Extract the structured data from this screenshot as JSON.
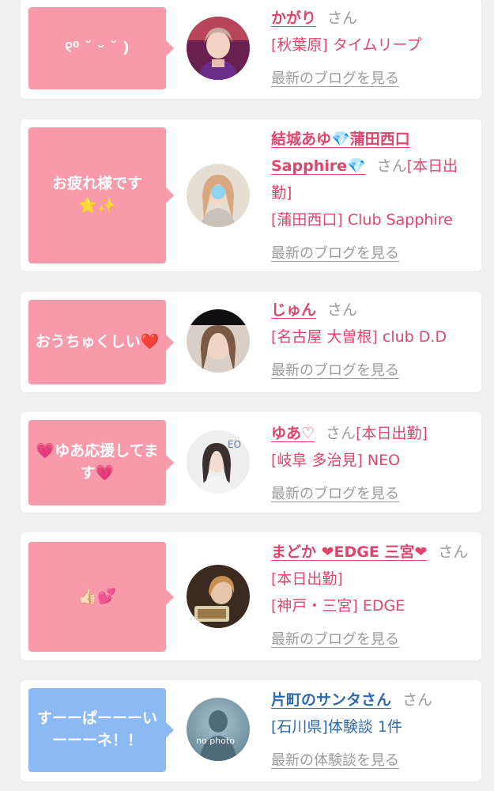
{
  "colors": {
    "pink_bubble": "#f99aab",
    "blue_bubble": "#8ab9f3",
    "pink_text": "#e0456b",
    "blue_text": "#2f6aa8",
    "gray_text": "#9b9b9b"
  },
  "cards": [
    {
      "message": "୧⁰ ˘ ᵕ ˘ )",
      "name": "かがり",
      "san": "さん",
      "tag": "",
      "shop": "[秋葉原] タイムリープ",
      "link": "最新のブログを見る",
      "avatar": "profile-photo"
    },
    {
      "message": "お疲れ様です\n⭐✨",
      "name": "結城あゆ💎蒲田西口Sapphire💎",
      "san": "さん",
      "tag": "[本日出勤]",
      "shop": "[蒲田西口] Club Sapphire",
      "link": "最新のブログを見る",
      "avatar": "profile-photo"
    },
    {
      "message": "おうちゅくしい❤️",
      "name": "じゅん",
      "san": "さん",
      "tag": "",
      "shop": "[名古屋 大曽根] club D.D",
      "link": "最新のブログを見る",
      "avatar": "profile-photo"
    },
    {
      "message": "💗ゆあ応援してます💗",
      "name": "ゆあ♡",
      "san": "さん",
      "tag": "[本日出勤]",
      "shop": "[岐阜 多治見] NEO",
      "link": "最新のブログを見る",
      "avatar": "profile-photo"
    },
    {
      "message": "👍🏻💕",
      "name": "まどか ❤EDGE 三宮❤",
      "san": "さん",
      "tag": "[本日出勤]",
      "shop": "[神戸・三宮] EDGE",
      "link": "最新のブログを見る",
      "avatar": "profile-photo"
    },
    {
      "message": "すーーぱーーーいーーーネ！！",
      "name": "片町のサンタさん",
      "san": "さん",
      "tag": "",
      "shop": "[石川県]体験談 1件",
      "link": "最新の体験談を見る",
      "avatar": "no-photo",
      "avatar_text": "no photo"
    }
  ]
}
